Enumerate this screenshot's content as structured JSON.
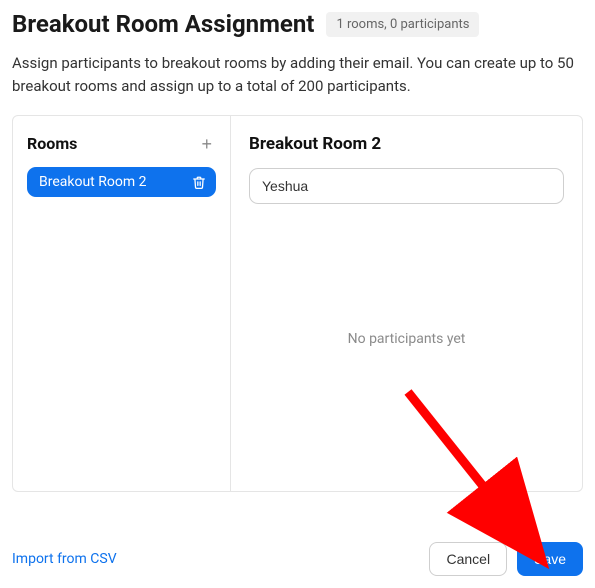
{
  "header": {
    "title": "Breakout Room Assignment",
    "badge": "1 rooms, 0 participants"
  },
  "description": "Assign participants to breakout rooms by adding their email. You can create up to 50 breakout rooms and assign up to a total of 200 participants.",
  "left": {
    "heading": "Rooms",
    "add_icon": "+",
    "rooms": [
      {
        "label": "Breakout Room 2"
      }
    ]
  },
  "right": {
    "heading": "Breakout Room 2",
    "input_value": "Yeshua",
    "empty_text": "No participants yet"
  },
  "footer": {
    "import": "Import from CSV",
    "cancel": "Cancel",
    "save": "Save"
  }
}
